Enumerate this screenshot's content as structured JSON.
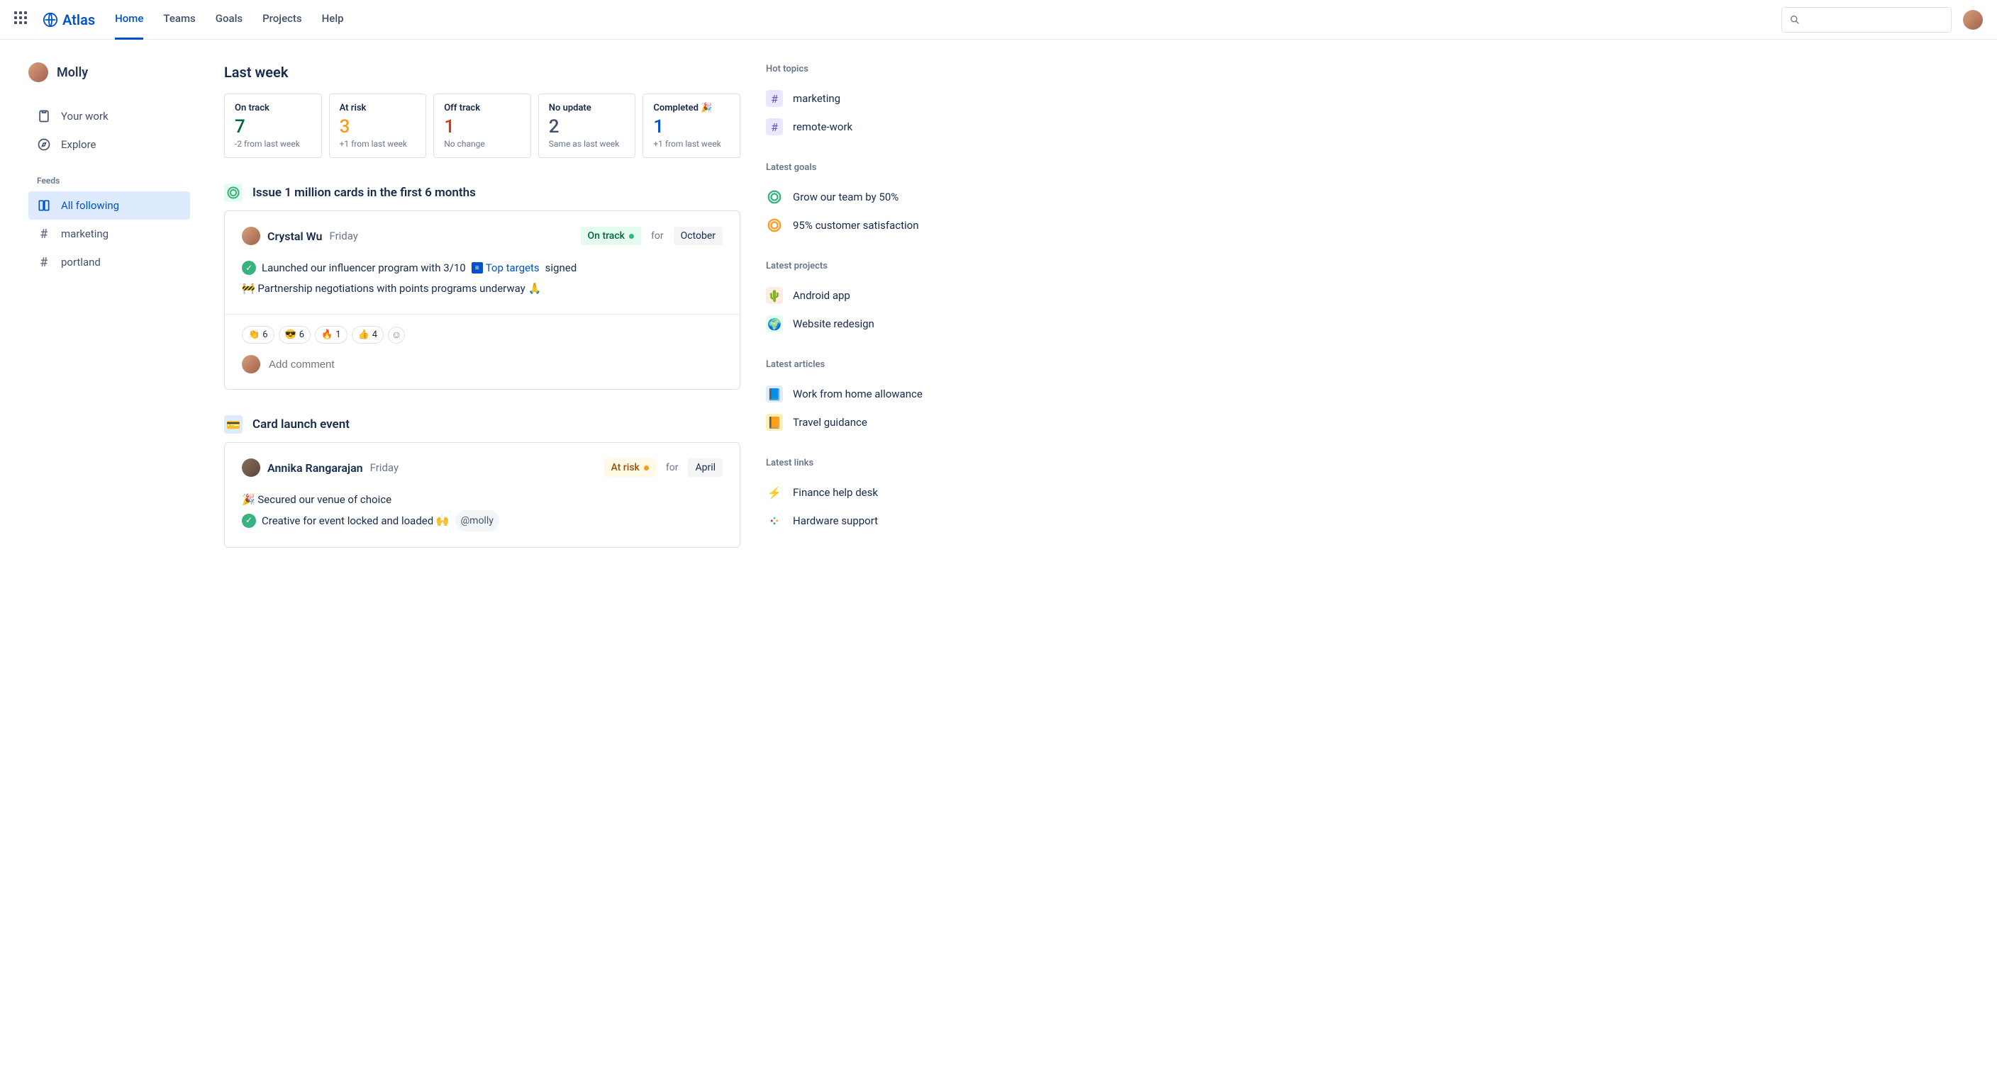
{
  "brand": "Atlas",
  "nav": {
    "home": "Home",
    "teams": "Teams",
    "goals": "Goals",
    "projects": "Projects",
    "help": "Help"
  },
  "user": {
    "name": "Molly"
  },
  "sidenav": {
    "your_work": "Your work",
    "explore": "Explore",
    "feeds_label": "Feeds"
  },
  "feeds": {
    "all": "All following",
    "marketing": "marketing",
    "portland": "portland"
  },
  "main_heading": "Last week",
  "stats": {
    "ontrack": {
      "label": "On track",
      "num": "7",
      "delta": "-2 from last week"
    },
    "atrisk": {
      "label": "At risk",
      "num": "3",
      "delta": "+1 from last week"
    },
    "offtrack": {
      "label": "Off track",
      "num": "1",
      "delta": "No change"
    },
    "noupdate": {
      "label": "No update",
      "num": "2",
      "delta": "Same as last week"
    },
    "completed": {
      "label": "Completed 🎉",
      "num": "1",
      "delta": "+1 from last week"
    }
  },
  "feed1": {
    "title": "Issue 1 million cards in the first 6 months",
    "author": "Crystal Wu",
    "when": "Friday",
    "status": "On track",
    "for": "for",
    "month": "October",
    "line1_a": "Launched our influencer program with 3/10",
    "line1_link": "Top targets",
    "line1_b": "signed",
    "line2": "🚧 Partnership negotiations with points programs underway 🙏",
    "reactions": {
      "r1": "6",
      "r2": "6",
      "r3": "1",
      "r4": "4"
    },
    "comment_placeholder": "Add comment"
  },
  "feed2": {
    "title": "Card launch event",
    "author": "Annika Rangarajan",
    "when": "Friday",
    "status": "At risk",
    "for": "for",
    "month": "April",
    "line1": "🎉 Secured our venue of choice",
    "line2": "Creative for event locked and loaded 🙌",
    "mention": "@molly"
  },
  "right": {
    "hot_topics": "Hot topics",
    "ht1": "marketing",
    "ht2": "remote-work",
    "latest_goals": "Latest goals",
    "lg1": "Grow our team by 50%",
    "lg2": "95% customer satisfaction",
    "latest_projects": "Latest projects",
    "lp1": "Android app",
    "lp2": "Website redesign",
    "latest_articles": "Latest articles",
    "la1": "Work from home allowance",
    "la2": "Travel guidance",
    "latest_links": "Latest links",
    "ll1": "Finance help desk",
    "ll2": "Hardware support"
  }
}
